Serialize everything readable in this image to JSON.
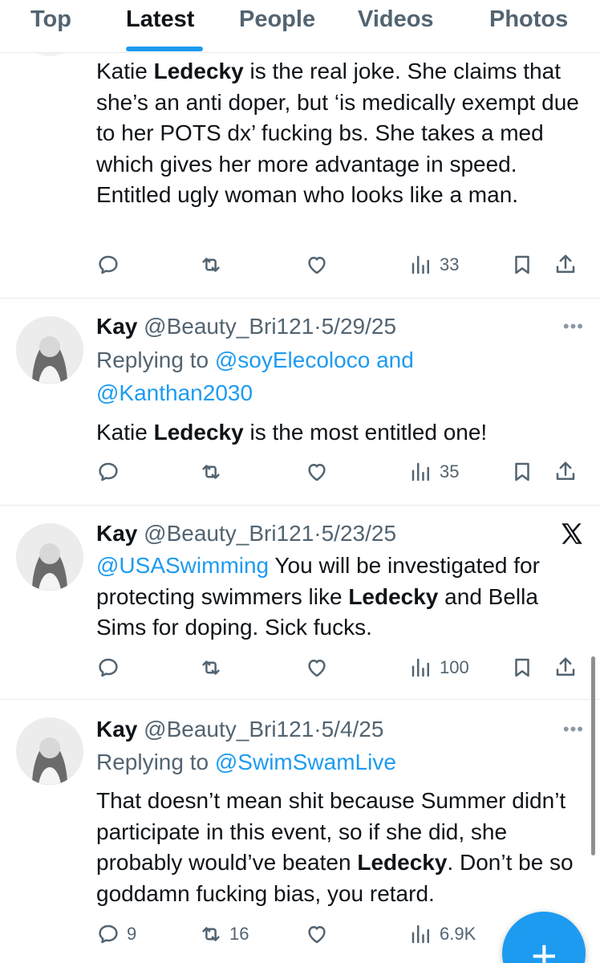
{
  "tabs": [
    "Top",
    "Latest",
    "People",
    "Videos",
    "Photos"
  ],
  "active_tab": "Latest",
  "tweets": [
    {
      "body": [
        {
          "text": "Katie "
        },
        {
          "text": "Ledecky",
          "bold": true
        },
        {
          "text": " is the real joke. She claims that she’s an anti doper, but ‘is medically exempt due to her POTS dx’ fucking bs. She takes a med which gives her more advantage in speed. Entitled ugly woman who looks like a man."
        }
      ],
      "stats": {
        "replies": "",
        "retweets": "",
        "views": "33"
      }
    },
    {
      "name": "Kay",
      "handle": "@Beauty_Bri121",
      "date": "5/29/25",
      "replying_label": "Replying to",
      "replying_line1_mention": "@soyElecoloco",
      "replying_and": "and",
      "replying_line2_mention": "@Kanthan2030",
      "body": [
        {
          "text": "Katie "
        },
        {
          "text": "Ledecky",
          "bold": true
        },
        {
          "text": " is the most entitled one!"
        }
      ],
      "stats": {
        "replies": "",
        "retweets": "",
        "views": "35"
      }
    },
    {
      "name": "Kay",
      "handle": "@Beauty_Bri121",
      "date": "5/23/25",
      "body": [
        {
          "text": "@USASwimming",
          "mention": true
        },
        {
          "text": " You will be investigated for protecting swimmers like "
        },
        {
          "text": "Ledecky",
          "bold": true
        },
        {
          "text": " and Bella Sims for doping. Sick fucks."
        }
      ],
      "stats": {
        "replies": "",
        "retweets": "",
        "views": "100"
      }
    },
    {
      "name": "Kay",
      "handle": "@Beauty_Bri121",
      "date": "5/4/25",
      "replying_label": "Replying to",
      "replying_line1_mention": "@SwimSwamLive",
      "body": [
        {
          "text": "That doesn’t mean shit because Summer didn’t participate in this event, so if she did, she probably would’ve beaten "
        },
        {
          "text": "Ledecky",
          "bold": true
        },
        {
          "text": ". Don’t be so goddamn fucking bias, you retard."
        }
      ],
      "stats": {
        "replies": "9",
        "retweets": "16",
        "views": "6.9K"
      }
    }
  ],
  "more_glyph": "•••",
  "fab_label": "+",
  "colors": {
    "accent": "#1d9bf0",
    "text": "#0f1419",
    "muted": "#536471",
    "divider": "#e6ecf0"
  }
}
